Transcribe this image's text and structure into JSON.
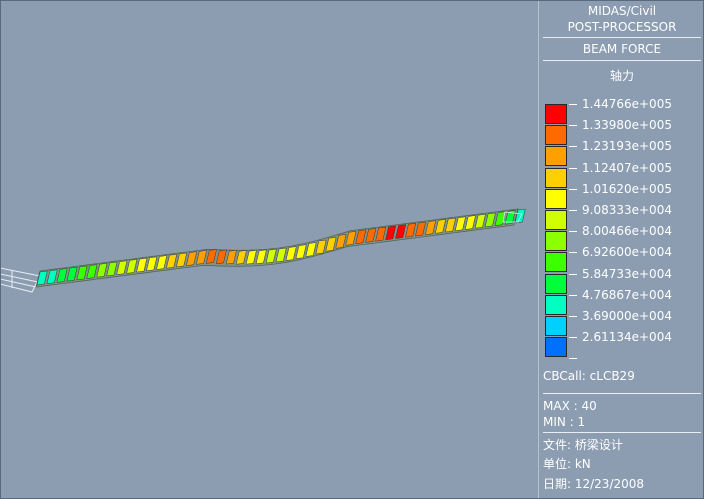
{
  "legend": {
    "app": "MIDAS/Civil",
    "module": "POST-PROCESSOR",
    "result_type": "BEAM FORCE",
    "component": "轴力",
    "scale": [
      {
        "value": "1.44766e+005",
        "color": "#ff0000"
      },
      {
        "value": "1.33980e+005",
        "color": "#ff6a00"
      },
      {
        "value": "1.23193e+005",
        "color": "#ffa000"
      },
      {
        "value": "1.12407e+005",
        "color": "#ffd000"
      },
      {
        "value": "1.01620e+005",
        "color": "#ffff00"
      },
      {
        "value": "9.08333e+004",
        "color": "#cfff00"
      },
      {
        "value": "8.00466e+004",
        "color": "#8cff00"
      },
      {
        "value": "6.92600e+004",
        "color": "#3cff00"
      },
      {
        "value": "5.84733e+004",
        "color": "#00ff3a"
      },
      {
        "value": "4.76867e+004",
        "color": "#00ffc0"
      },
      {
        "value": "3.69000e+004",
        "color": "#00d0ff"
      },
      {
        "value": "2.61134e+004",
        "color": "#0070ff"
      }
    ],
    "cbcall": "CBCall: cLCB29",
    "max": "MAX : 40",
    "min": "MIN : 1",
    "file": "文件: 桥梁设计",
    "unit": "单位: kN",
    "date": "日期: 12/23/2008"
  }
}
